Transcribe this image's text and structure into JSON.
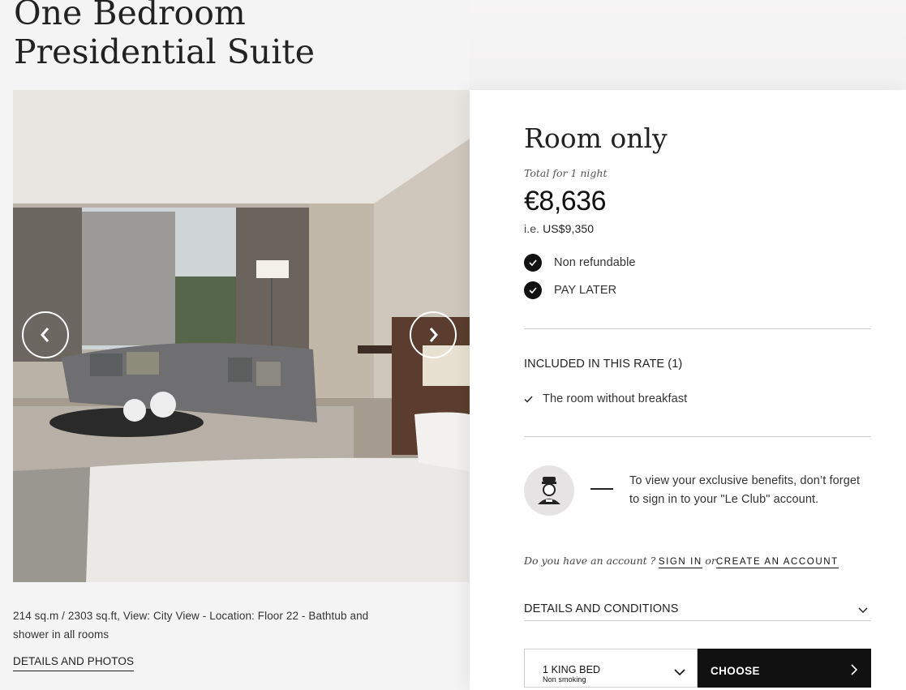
{
  "room": {
    "title": "One Bedroom Presidential Suite",
    "description": "214 sq.m / 2303 sq.ft, View: City View - Location: Floor 22 - Bathtub and shower in all rooms",
    "details_link": "DETAILS AND PHOTOS"
  },
  "rate": {
    "title": "Room only",
    "total_label": "Total for 1 night",
    "price": "€8,636",
    "price_prefix": "i.e.",
    "price_usd": "US$9,350",
    "conditions": [
      "Non refundable",
      "PAY LATER"
    ],
    "included_title": "INCLUDED IN THIS RATE (1)",
    "included_items": [
      "The room without breakfast"
    ]
  },
  "benefits": {
    "text": "To view your exclusive benefits, don’t forget to sign in to your \"Le Club\" account."
  },
  "account": {
    "question": "Do you have an account ?",
    "sign_in": "SIGN IN",
    "or": "or",
    "create": "CREATE AN ACCOUNT"
  },
  "details_conditions": "DETAILS AND CONDITIONS",
  "booking": {
    "bed_label": "1 KING BED",
    "bed_sub": "Non smoking",
    "choose_label": "CHOOSE"
  },
  "colors": {
    "background": "#f5f4f4",
    "panel": "#ffffff",
    "primary_dark": "#111111"
  },
  "icons": [
    "chevron-left-icon",
    "chevron-right-icon",
    "check-icon",
    "concierge-icon",
    "chevron-down-icon",
    "arrow-right-icon"
  ]
}
